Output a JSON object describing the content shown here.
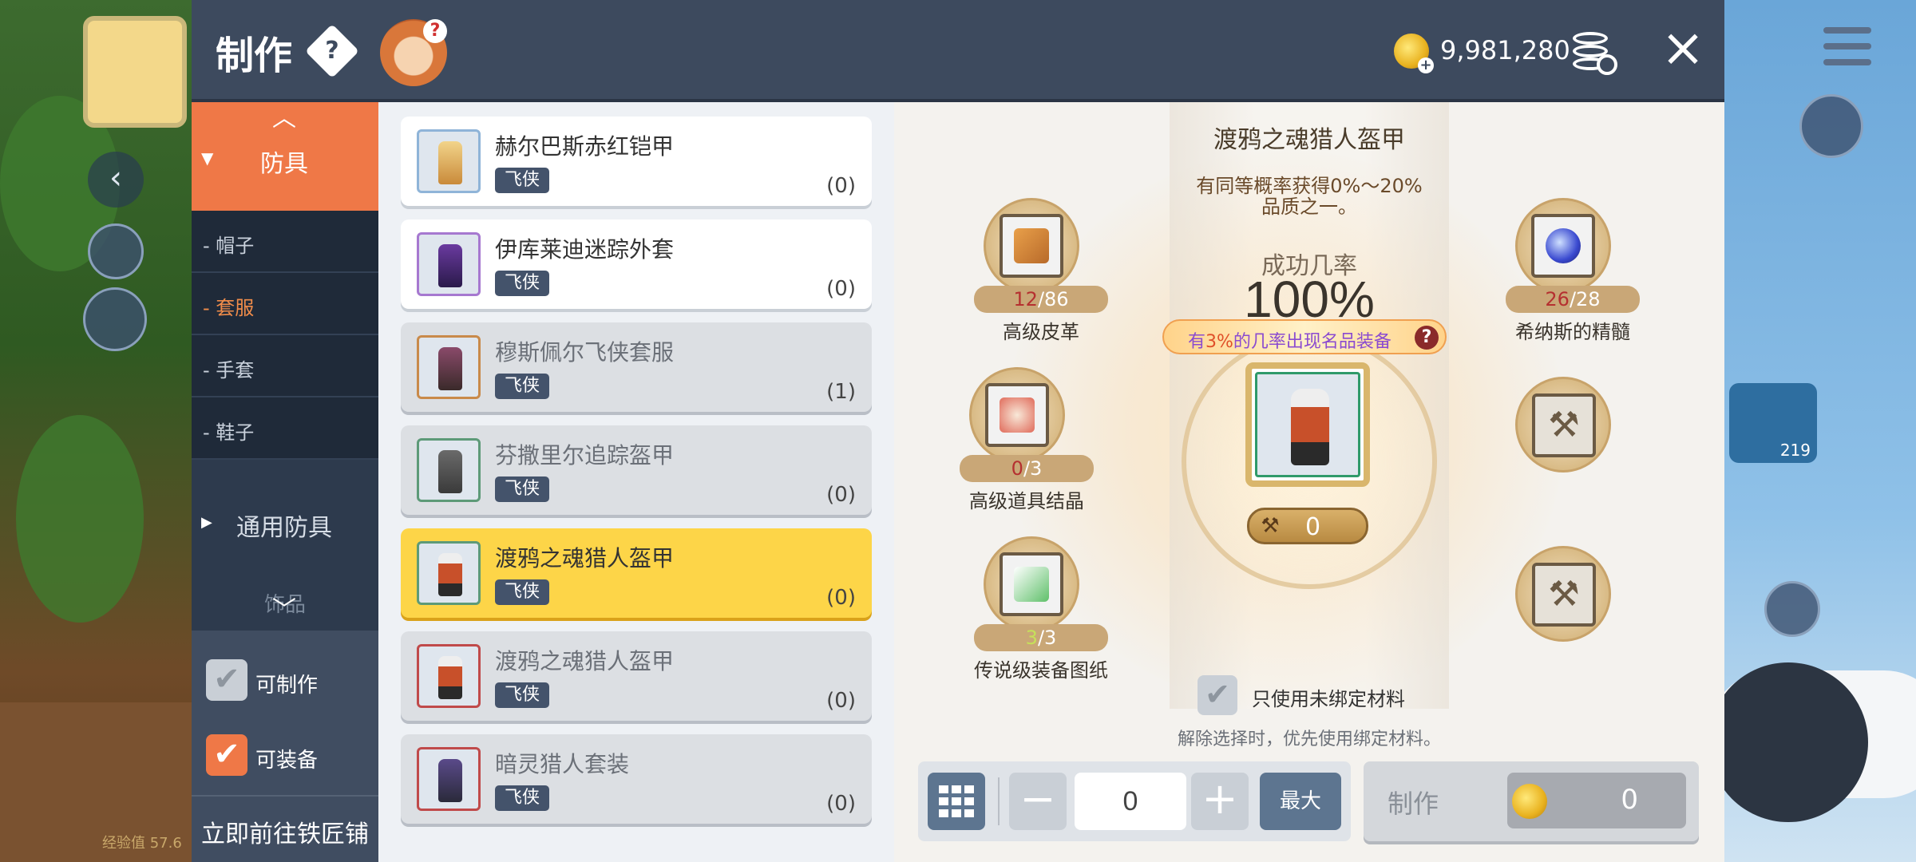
{
  "header": {
    "title": "制作",
    "help": "?",
    "meso": "9,981,280",
    "close": "×"
  },
  "nav": {
    "active_category": "防具",
    "sub_items": [
      "帽子",
      "套服",
      "手套",
      "鞋子"
    ],
    "selected_sub_index": 1,
    "group": "通用防具",
    "faded": "饰品",
    "filters": [
      {
        "label": "可制作",
        "checked": false
      },
      {
        "label": "可装备",
        "checked": true
      }
    ],
    "smith_link": "立即前往铁匠铺"
  },
  "items": [
    {
      "name": "赫尔巴斯赤红铠甲",
      "tag": "飞侠",
      "count": "(0)",
      "state": "normal",
      "frame": "blue"
    },
    {
      "name": "伊库莱迪迷踪外套",
      "tag": "飞侠",
      "count": "(0)",
      "state": "normal",
      "frame": "purple"
    },
    {
      "name": "穆斯佩尔飞侠套服",
      "tag": "飞侠",
      "count": "(1)",
      "state": "dim",
      "frame": "orange"
    },
    {
      "name": "芬撒里尔追踪盔甲",
      "tag": "飞侠",
      "count": "(0)",
      "state": "dim",
      "frame": "green"
    },
    {
      "name": "渡鸦之魂猎人盔甲",
      "tag": "飞侠",
      "count": "(0)",
      "state": "selected",
      "frame": "green"
    },
    {
      "name": "渡鸦之魂猎人盔甲",
      "tag": "飞侠",
      "count": "(0)",
      "state": "dim",
      "frame": "red"
    },
    {
      "name": "暗灵猎人套装",
      "tag": "飞侠",
      "count": "(0)",
      "state": "dim",
      "frame": "red"
    }
  ],
  "detail": {
    "title": "渡鸦之魂猎人盔甲",
    "desc_line1": "有同等概率获得0%～20%",
    "desc_line2": "品质之一。",
    "rate_label": "成功几率",
    "rate": "100%",
    "banner_pre": "有",
    "banner_pct": "3%",
    "banner_post": "的几率出现名品装备",
    "banner_help": "?",
    "result_counter": "0",
    "materials": [
      {
        "name": "高级皮革",
        "have": "12",
        "need": "/86",
        "enough": false,
        "icon": "scroll-icon"
      },
      {
        "name": "高级道具结晶",
        "have": "0",
        "need": "/3",
        "enough": false,
        "icon": "crystal-icon"
      },
      {
        "name": "传说级装备图纸",
        "have": "3",
        "need": "/3",
        "enough": true,
        "icon": "blueprint-icon"
      },
      {
        "name": "希纳斯的精髓",
        "have": "26",
        "need": "/28",
        "enough": false,
        "icon": "essence-orb-icon"
      }
    ],
    "only_unbound_label": "只使用未绑定材料",
    "only_unbound_checked": false,
    "bind_note": "解除选择时，优先使用绑定材料。",
    "quantity": "0",
    "max_label": "最大",
    "craft_label": "制作",
    "craft_cost": "0"
  },
  "background": {
    "exp_text": "经验值 57.6",
    "item_count": "219"
  },
  "colors": {
    "accent": "#ef7847",
    "header": "#3d4a5e",
    "selected_card": "#fdd548",
    "tag": "#44536b"
  }
}
